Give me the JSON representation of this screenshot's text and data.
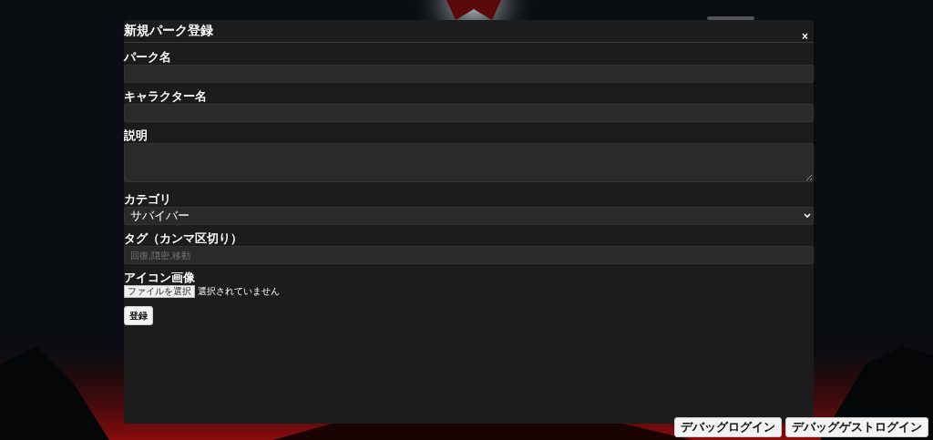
{
  "modal": {
    "title": "新規パーク登録",
    "close": "×",
    "fields": [
      {
        "kind": "text",
        "label": "パーク名"
      },
      {
        "kind": "text",
        "label": "キャラクター名"
      },
      {
        "kind": "textarea",
        "label": "説明"
      },
      {
        "kind": "select",
        "label": "カテゴリ",
        "value": "サバイバー"
      },
      {
        "kind": "text",
        "label": "タグ（カンマ区切り）",
        "placeholder": "回復,隠密,移動"
      },
      {
        "kind": "file",
        "label": "アイコン画像",
        "button": "ファイルを選択",
        "status": "選択されていません"
      }
    ],
    "submit": "登録"
  },
  "debug_buttons": [
    "デバッグログイン",
    "デバッグゲストログイン"
  ]
}
